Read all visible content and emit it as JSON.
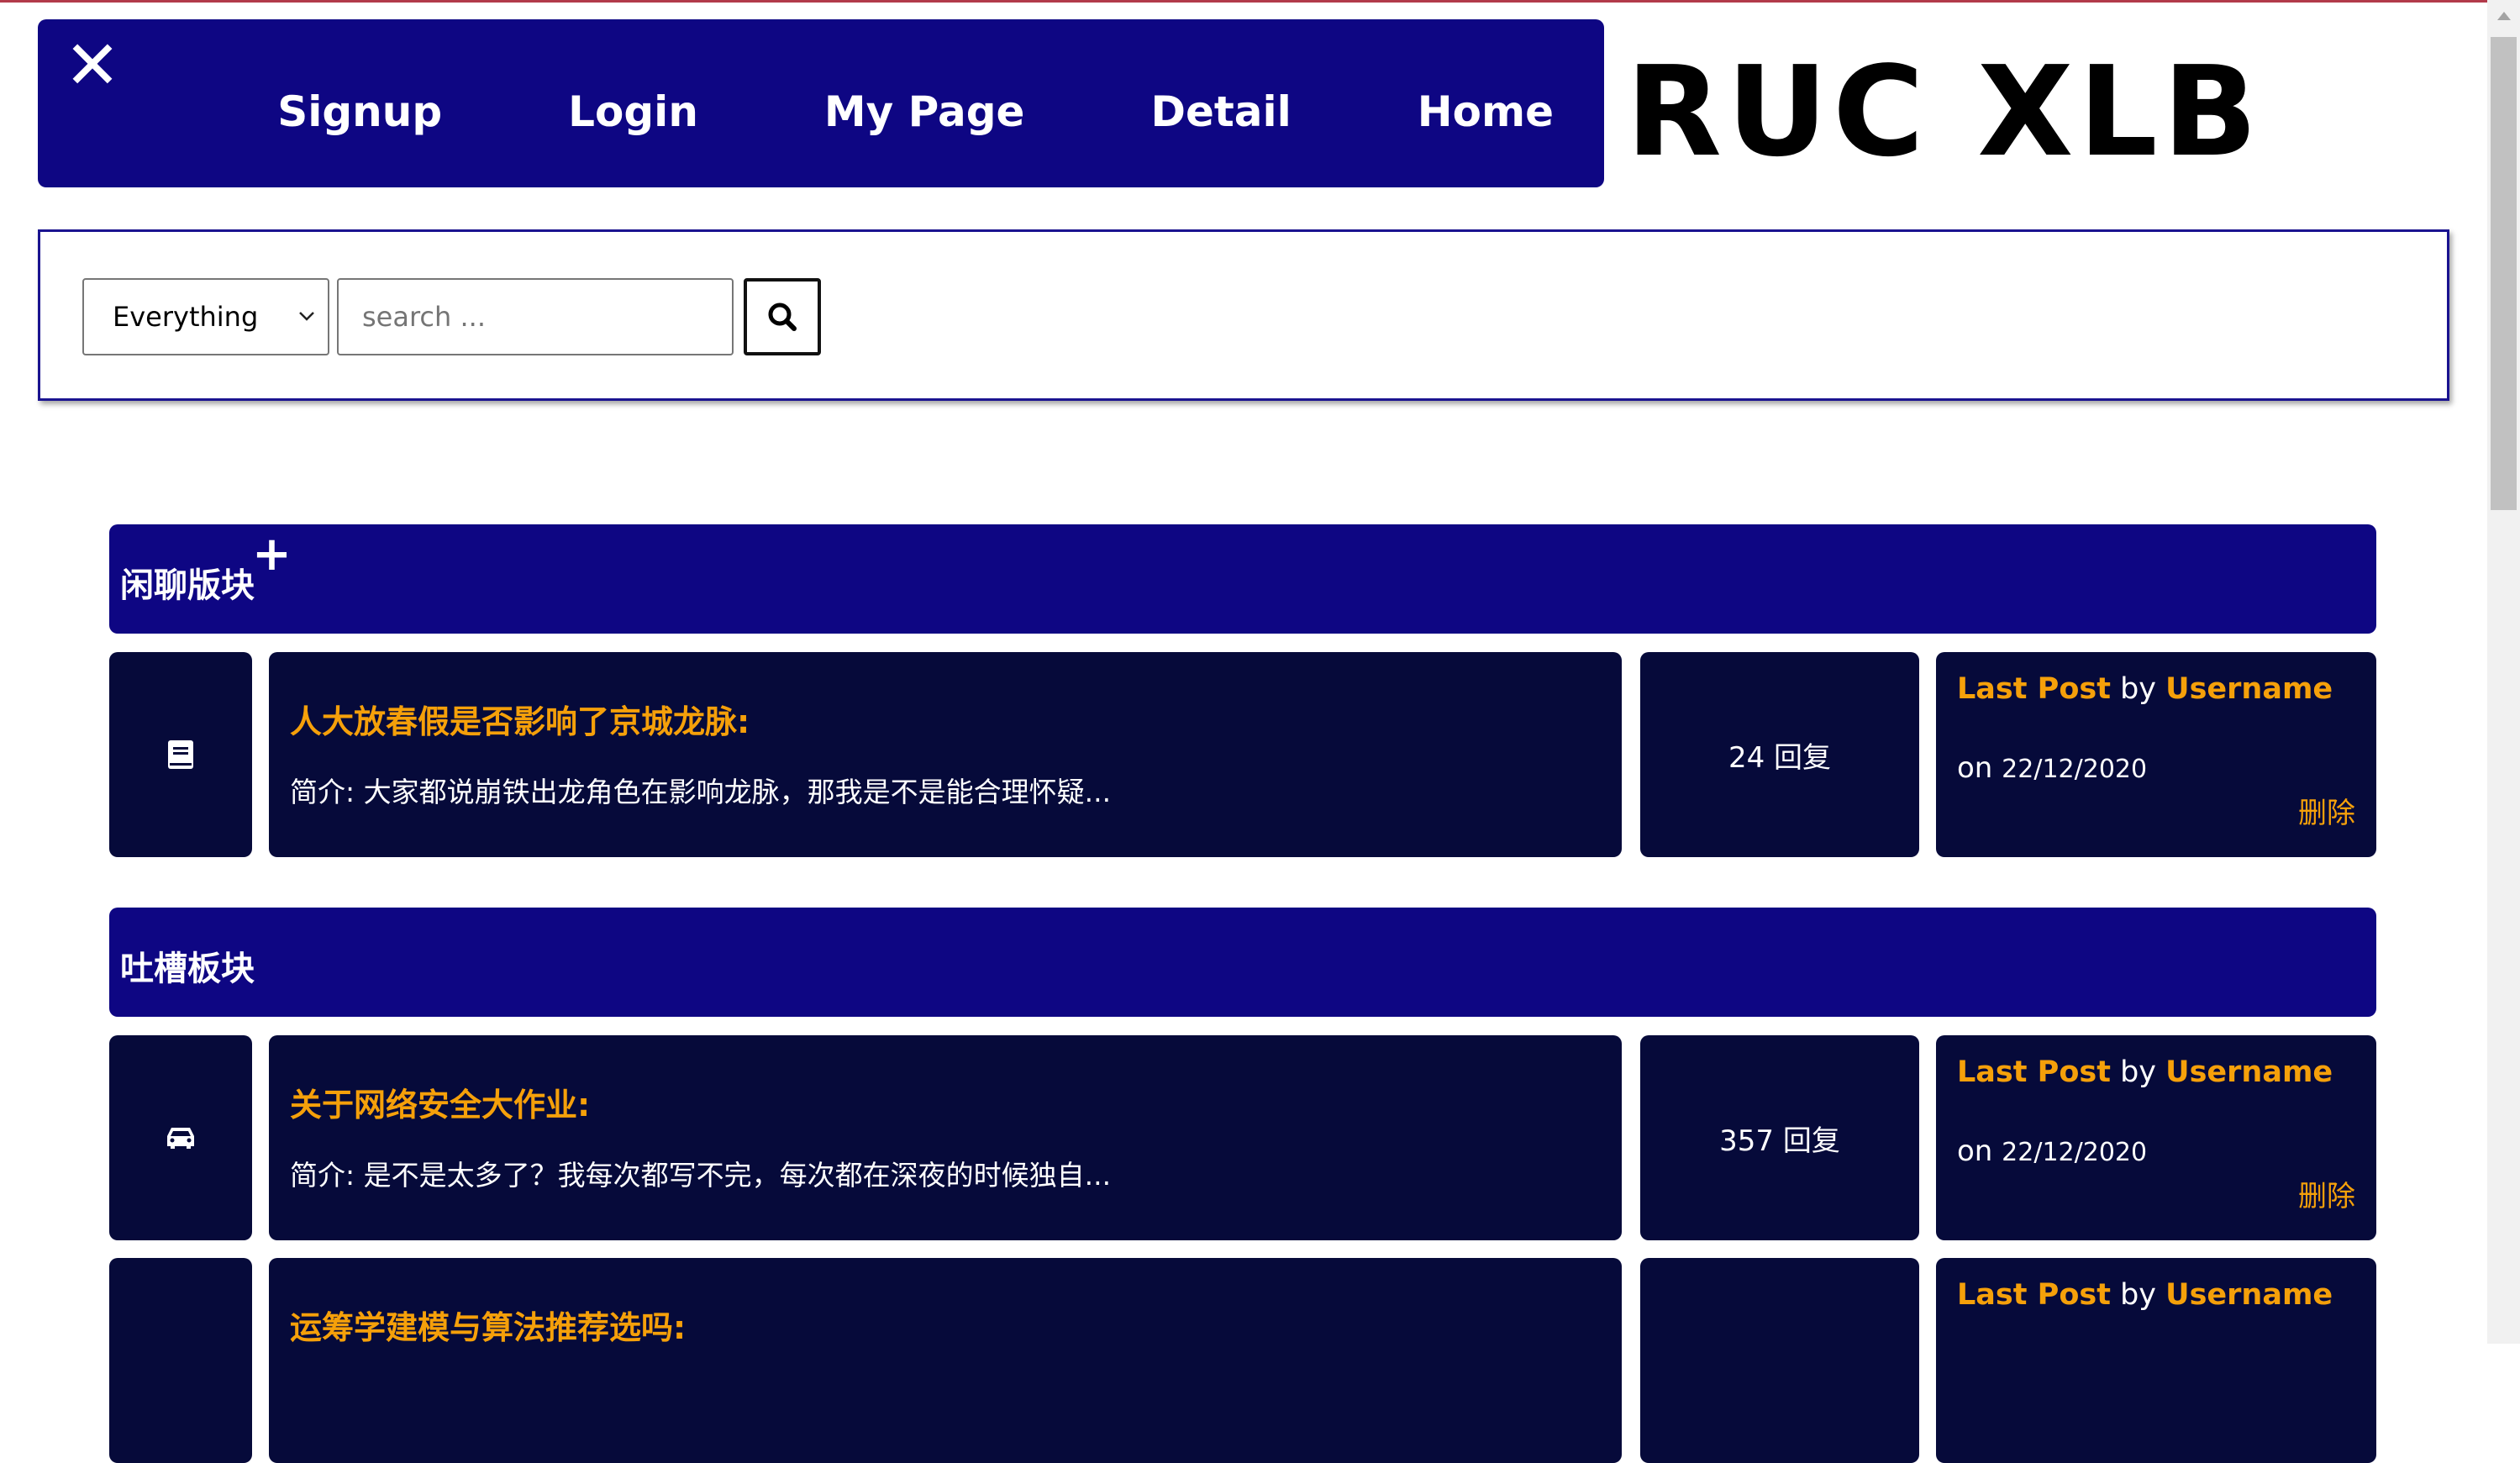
{
  "nav": {
    "close_symbol": "✕",
    "links": [
      "Signup",
      "Login",
      "My Page",
      "Detail",
      "Home"
    ]
  },
  "logo": {
    "text": "RUC XLB"
  },
  "search": {
    "category": "Everything",
    "placeholder": "search ...",
    "value": ""
  },
  "icons": {
    "search_button": "search-icon",
    "section1_row1": "book-icon",
    "section2_row1": "car-icon"
  },
  "colors": {
    "nav_bg": "#0e0683",
    "row_bg": "#060a3a",
    "accent": "#f5a00a",
    "text": "#ffffff"
  },
  "sections": [
    {
      "title": "闲聊版块",
      "add_symbol": "+",
      "threads": [
        {
          "title": "人大放春假是否影响了京城龙脉:",
          "summary": "简介: 大家都说崩铁出龙角色在影响龙脉，那我是不是能合理怀疑...",
          "replies": "24 回复",
          "last_post_label": "Last Post",
          "by": "by",
          "username": "Username",
          "on": "on",
          "date": "22/12/2020",
          "delete": "删除"
        }
      ]
    },
    {
      "title": "吐槽板块",
      "threads": [
        {
          "title": "关于网络安全大作业:",
          "summary": "简介: 是不是太多了？我每次都写不完，每次都在深夜的时候独自...",
          "replies": "357 回复",
          "last_post_label": "Last Post",
          "by": "by",
          "username": "Username",
          "on": "on",
          "date": "22/12/2020",
          "delete": "删除"
        },
        {
          "title": "运筹学建模与算法推荐选吗:",
          "last_post_label": "Last Post",
          "by": "by",
          "username": "Username"
        }
      ]
    }
  ]
}
